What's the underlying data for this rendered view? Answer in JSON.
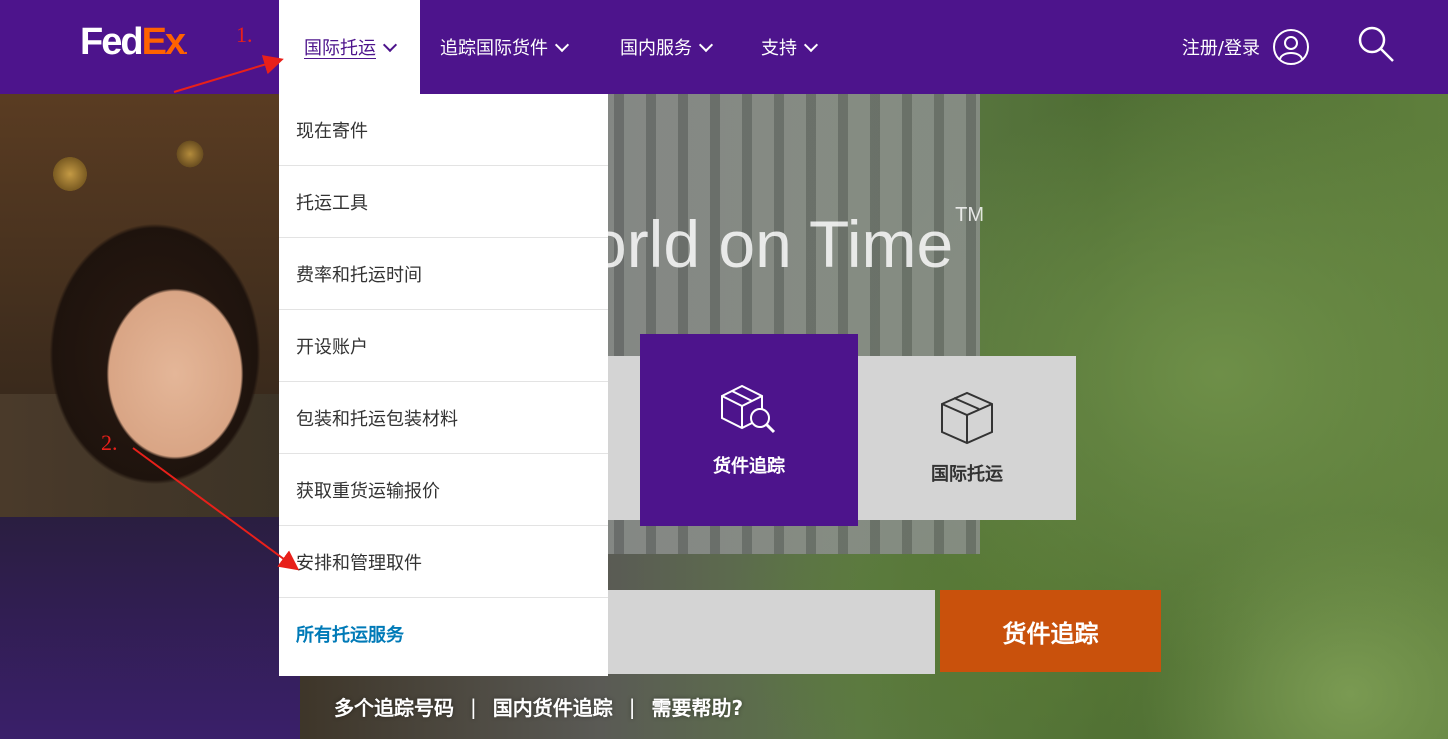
{
  "header": {
    "logo": {
      "fed": "Fed",
      "ex": "Ex",
      "dot": "."
    },
    "nav": [
      {
        "label": "国际托运"
      },
      {
        "label": "追踪国际货件"
      },
      {
        "label": "国内服务"
      },
      {
        "label": "支持"
      }
    ],
    "login_label": "注册/登录"
  },
  "dropdown": {
    "items": [
      {
        "label": "现在寄件"
      },
      {
        "label": "托运工具"
      },
      {
        "label": "费率和托运时间"
      },
      {
        "label": "开设账户"
      },
      {
        "label": "包装和托运包装材料"
      },
      {
        "label": "获取重货运输报价"
      },
      {
        "label": "安排和管理取件"
      }
    ],
    "all_label": "所有托运服务"
  },
  "hero": {
    "tagline": "orld on Time",
    "tm": "TM"
  },
  "tiles": {
    "track_label": "货件追踪",
    "ship_label": "国际托运"
  },
  "tracking": {
    "input_value": "",
    "button_label": "货件追踪"
  },
  "links": {
    "multi": "多个追踪号码",
    "domestic": "国内货件追踪",
    "help": "需要帮助?"
  },
  "annotations": {
    "step1": "1.",
    "step2": "2."
  },
  "colors": {
    "brand_purple": "#4d148c",
    "brand_orange": "#ff6200",
    "track_button": "#c9510c",
    "link_blue": "#007ab7",
    "annotation_red": "#e8201a"
  }
}
